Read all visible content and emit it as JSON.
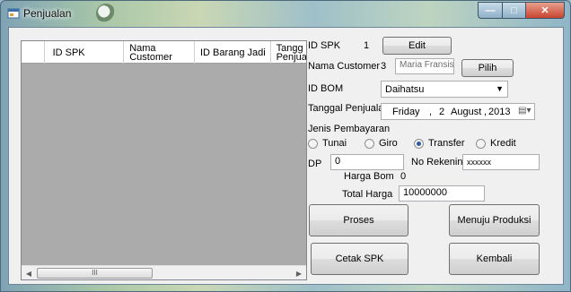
{
  "window": {
    "title": "Penjualan",
    "min_glyph": "—",
    "max_glyph": "□",
    "close_glyph": "✕"
  },
  "grid": {
    "columns": [
      "ID SPK",
      "Nama Customer",
      "ID Barang Jadi",
      "Tanggal Penjualan"
    ],
    "column_display": [
      "ID SPK",
      "Nama\nCustomer",
      "ID Barang Jadi",
      "Tangg\nPenjua"
    ],
    "rows": [],
    "scroll_left": "◀",
    "scroll_right": "▶",
    "thumb_grip": "III"
  },
  "form": {
    "id_spk_label": "ID SPK",
    "id_spk_value": "1",
    "edit_button": "Edit",
    "nama_customer_label": "Nama Customer",
    "nama_customer_id": "3",
    "nama_customer_value": "Maria Fransisca",
    "pilih_button": "Pilih",
    "id_bom_label": "ID BOM",
    "id_bom_value": "Daihatsu",
    "tanggal_label": "Tanggal Penjualan",
    "tanggal": {
      "day": "Friday",
      "date": "2",
      "month": "August",
      "year": "2013"
    },
    "jenis_label": "Jenis Pembayaran",
    "payment_options": [
      "Tunai",
      "Giro",
      "Transfer",
      "Kredit"
    ],
    "payment_selected": "Transfer",
    "dp_label": "DP",
    "dp_value": "0",
    "no_rek_label": "No Rekening",
    "no_rek_value": "xxxxxx",
    "harga_bom_label": "Harga Bom",
    "harga_bom_value": "0",
    "total_harga_label": "Total Harga",
    "total_harga_value": "10000000",
    "proses_button": "Proses",
    "produksi_button": "Menuju Produksi",
    "cetak_button": "Cetak SPK",
    "kembali_button": "Kembali"
  },
  "colors": {
    "radio_selected": "#2c5a9c",
    "grid_background": "#ababab",
    "form_background": "#f0f0f0"
  }
}
